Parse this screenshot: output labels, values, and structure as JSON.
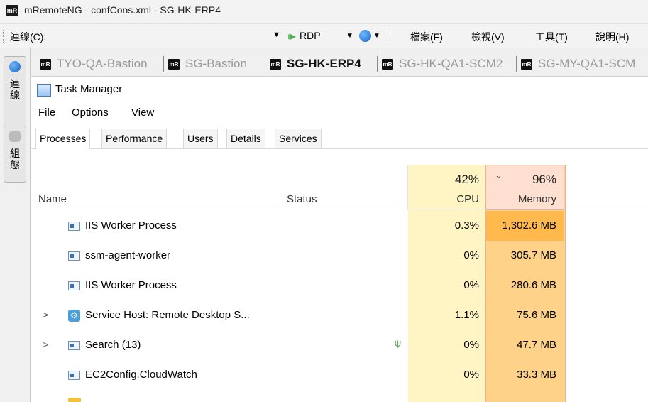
{
  "window": {
    "title": "mRemoteNG - confCons.xml - SG-HK-ERP4",
    "app_icon": "mR"
  },
  "toolbar": {
    "connect_label": "連線(C):",
    "connect_value": "",
    "protocol": "RDP",
    "menus": [
      "檔案(F)",
      "檢視(V)",
      "工具(T)",
      "說明(H)"
    ]
  },
  "sidepanel": {
    "tabs": [
      {
        "label": "連線",
        "icon": "globe-icon"
      },
      {
        "label": "組態",
        "icon": "gear-icon"
      }
    ]
  },
  "connection_tabs": [
    {
      "label": "TYO-QA-Bastion",
      "active": false
    },
    {
      "label": "SG-Bastion",
      "active": false
    },
    {
      "label": "SG-HK-ERP4",
      "active": true
    },
    {
      "label": "SG-HK-QA1-SCM2",
      "active": false
    },
    {
      "label": "SG-MY-QA1-SCM",
      "active": false
    }
  ],
  "task_manager": {
    "title": "Task Manager",
    "menus": [
      "File",
      "Options",
      "View"
    ],
    "tabs": [
      "Processes",
      "Performance",
      "Users",
      "Details",
      "Services"
    ],
    "columns": {
      "name": "Name",
      "status": "Status",
      "cpu_pct": "42%",
      "cpu": "CPU",
      "mem_pct": "96%",
      "mem": "Memory"
    },
    "rows": [
      {
        "name": "IIS Worker Process",
        "status": "",
        "cpu": "0.3%",
        "mem": "1,302.6 MB",
        "expandable": false,
        "icon": "window-icon"
      },
      {
        "name": "ssm-agent-worker",
        "status": "",
        "cpu": "0%",
        "mem": "305.7 MB",
        "expandable": false,
        "icon": "window-icon"
      },
      {
        "name": "IIS Worker Process",
        "status": "",
        "cpu": "0%",
        "mem": "280.6 MB",
        "expandable": false,
        "icon": "window-icon"
      },
      {
        "name": "Service Host: Remote Desktop S...",
        "status": "",
        "cpu": "1.1%",
        "mem": "75.6 MB",
        "expandable": true,
        "icon": "gear-icon"
      },
      {
        "name": "Search (13)",
        "status": "leaf-icon",
        "cpu": "0%",
        "mem": "47.7 MB",
        "expandable": true,
        "icon": "window-icon"
      },
      {
        "name": "EC2Config.CloudWatch",
        "status": "",
        "cpu": "0%",
        "mem": "33.3 MB",
        "expandable": false,
        "icon": "window-icon"
      }
    ]
  },
  "colors": {
    "cpu_col": "#fff4c4",
    "mem_col": "#ffd28a",
    "mem_header": "#ffe0d0",
    "mem_top_row": "#ffb94d"
  }
}
